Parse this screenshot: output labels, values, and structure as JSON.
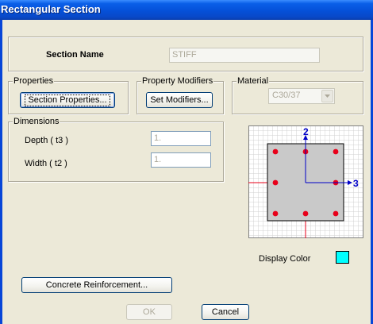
{
  "window": {
    "title": "Rectangular Section"
  },
  "section_name": {
    "label": "Section Name",
    "value": "STIFF"
  },
  "properties": {
    "group_label": "Properties",
    "button_label": "Section Properties..."
  },
  "property_modifiers": {
    "group_label": "Property Modifiers",
    "button_label": "Set Modifiers..."
  },
  "material": {
    "group_label": "Material",
    "selected": "C30/37"
  },
  "dimensions": {
    "group_label": "Dimensions",
    "depth_label": "Depth  ( t3 )",
    "depth_value": "1.",
    "width_label": "Width  ( t2 )",
    "width_value": "1."
  },
  "preview": {
    "axis_vertical_label": "2",
    "axis_horizontal_label": "3",
    "section_fill": "#C9C9C9",
    "rebar_color": "#E8001A",
    "axis_color": "#0000C8"
  },
  "display_color": {
    "label": "Display Color",
    "color": "#00FFFF"
  },
  "concrete_reinforcement": {
    "button_label": "Concrete Reinforcement..."
  },
  "footer": {
    "ok_label": "OK",
    "cancel_label": "Cancel"
  }
}
